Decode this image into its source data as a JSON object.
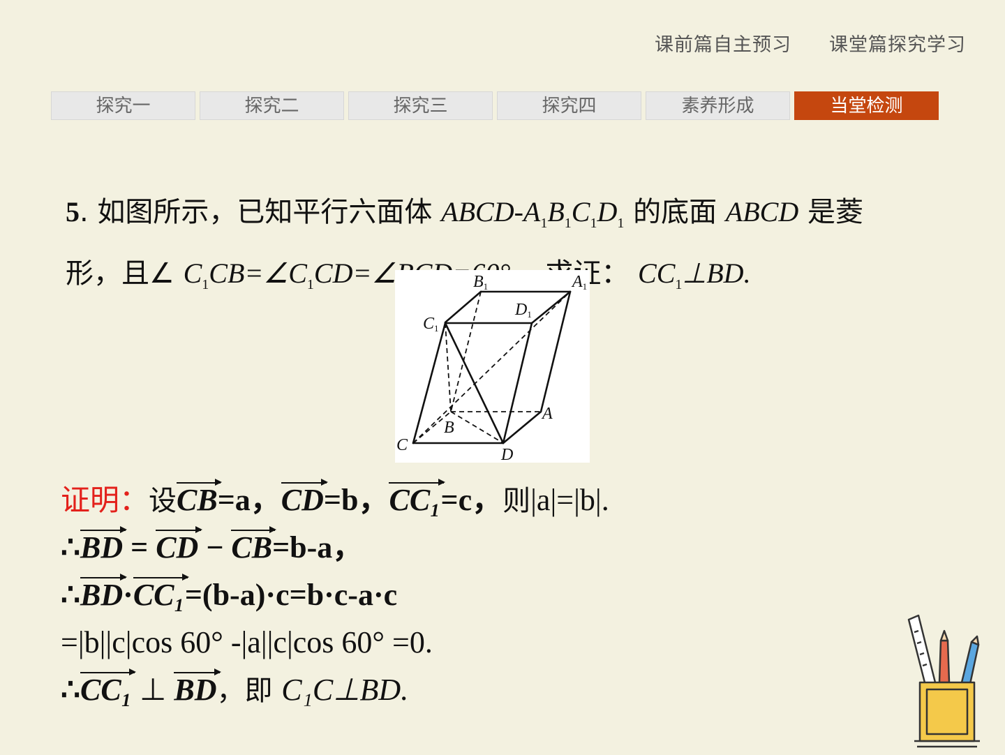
{
  "top_nav": {
    "item1": "课前篇自主预习",
    "item2": "课堂篇探究学习"
  },
  "tabs": [
    "探究一",
    "探究二",
    "探究三",
    "探究四",
    "素养形成",
    "当堂检测"
  ],
  "active_tab": "当堂检测",
  "accent_color": "#c5470f",
  "problem": {
    "number": "5",
    "t1": ". 如图所示，已知平行六面体 ",
    "t2": " 的底面 ",
    "t3": " 是菱",
    "t4": "形，且∠ ",
    "t5": "，求证： "
  },
  "figure_labels": {
    "B1": "B",
    "A1": "A",
    "D1": "D",
    "C1": "C",
    "A": "A",
    "B": "B",
    "C": "C",
    "D": "D",
    "sub": "1"
  },
  "proof": {
    "label": "证明：",
    "line1": {
      "set": "设",
      "vec_a": "CB",
      "eq_a": "=a，",
      "vec_b": "CD",
      "eq_b": "=b，",
      "vec_c": "CC₁",
      "eq_c": "=c，",
      "then": "则",
      "tail": "|a|=|b|."
    },
    "line2": {
      "therefore": "∴",
      "v1": "BD",
      "eq1": " = ",
      "v2": "CD",
      "minus": " − ",
      "v3": "CB",
      "tail": "=b-a，"
    },
    "line3": {
      "therefore": "∴",
      "v1": "BD",
      "dot": "·",
      "v2": "CC₁",
      "tail": "=(b-a)·c=b·c-a·c"
    },
    "line4": "=|b||c|cos 60° -|a||c|cos 60° =0.",
    "line5": {
      "therefore": "∴",
      "v1": "CC₁",
      "perp": " ⊥ ",
      "v2": "BD",
      "comma": "，",
      "namely": "即 ",
      "tail": "C₁C⊥BD."
    }
  }
}
